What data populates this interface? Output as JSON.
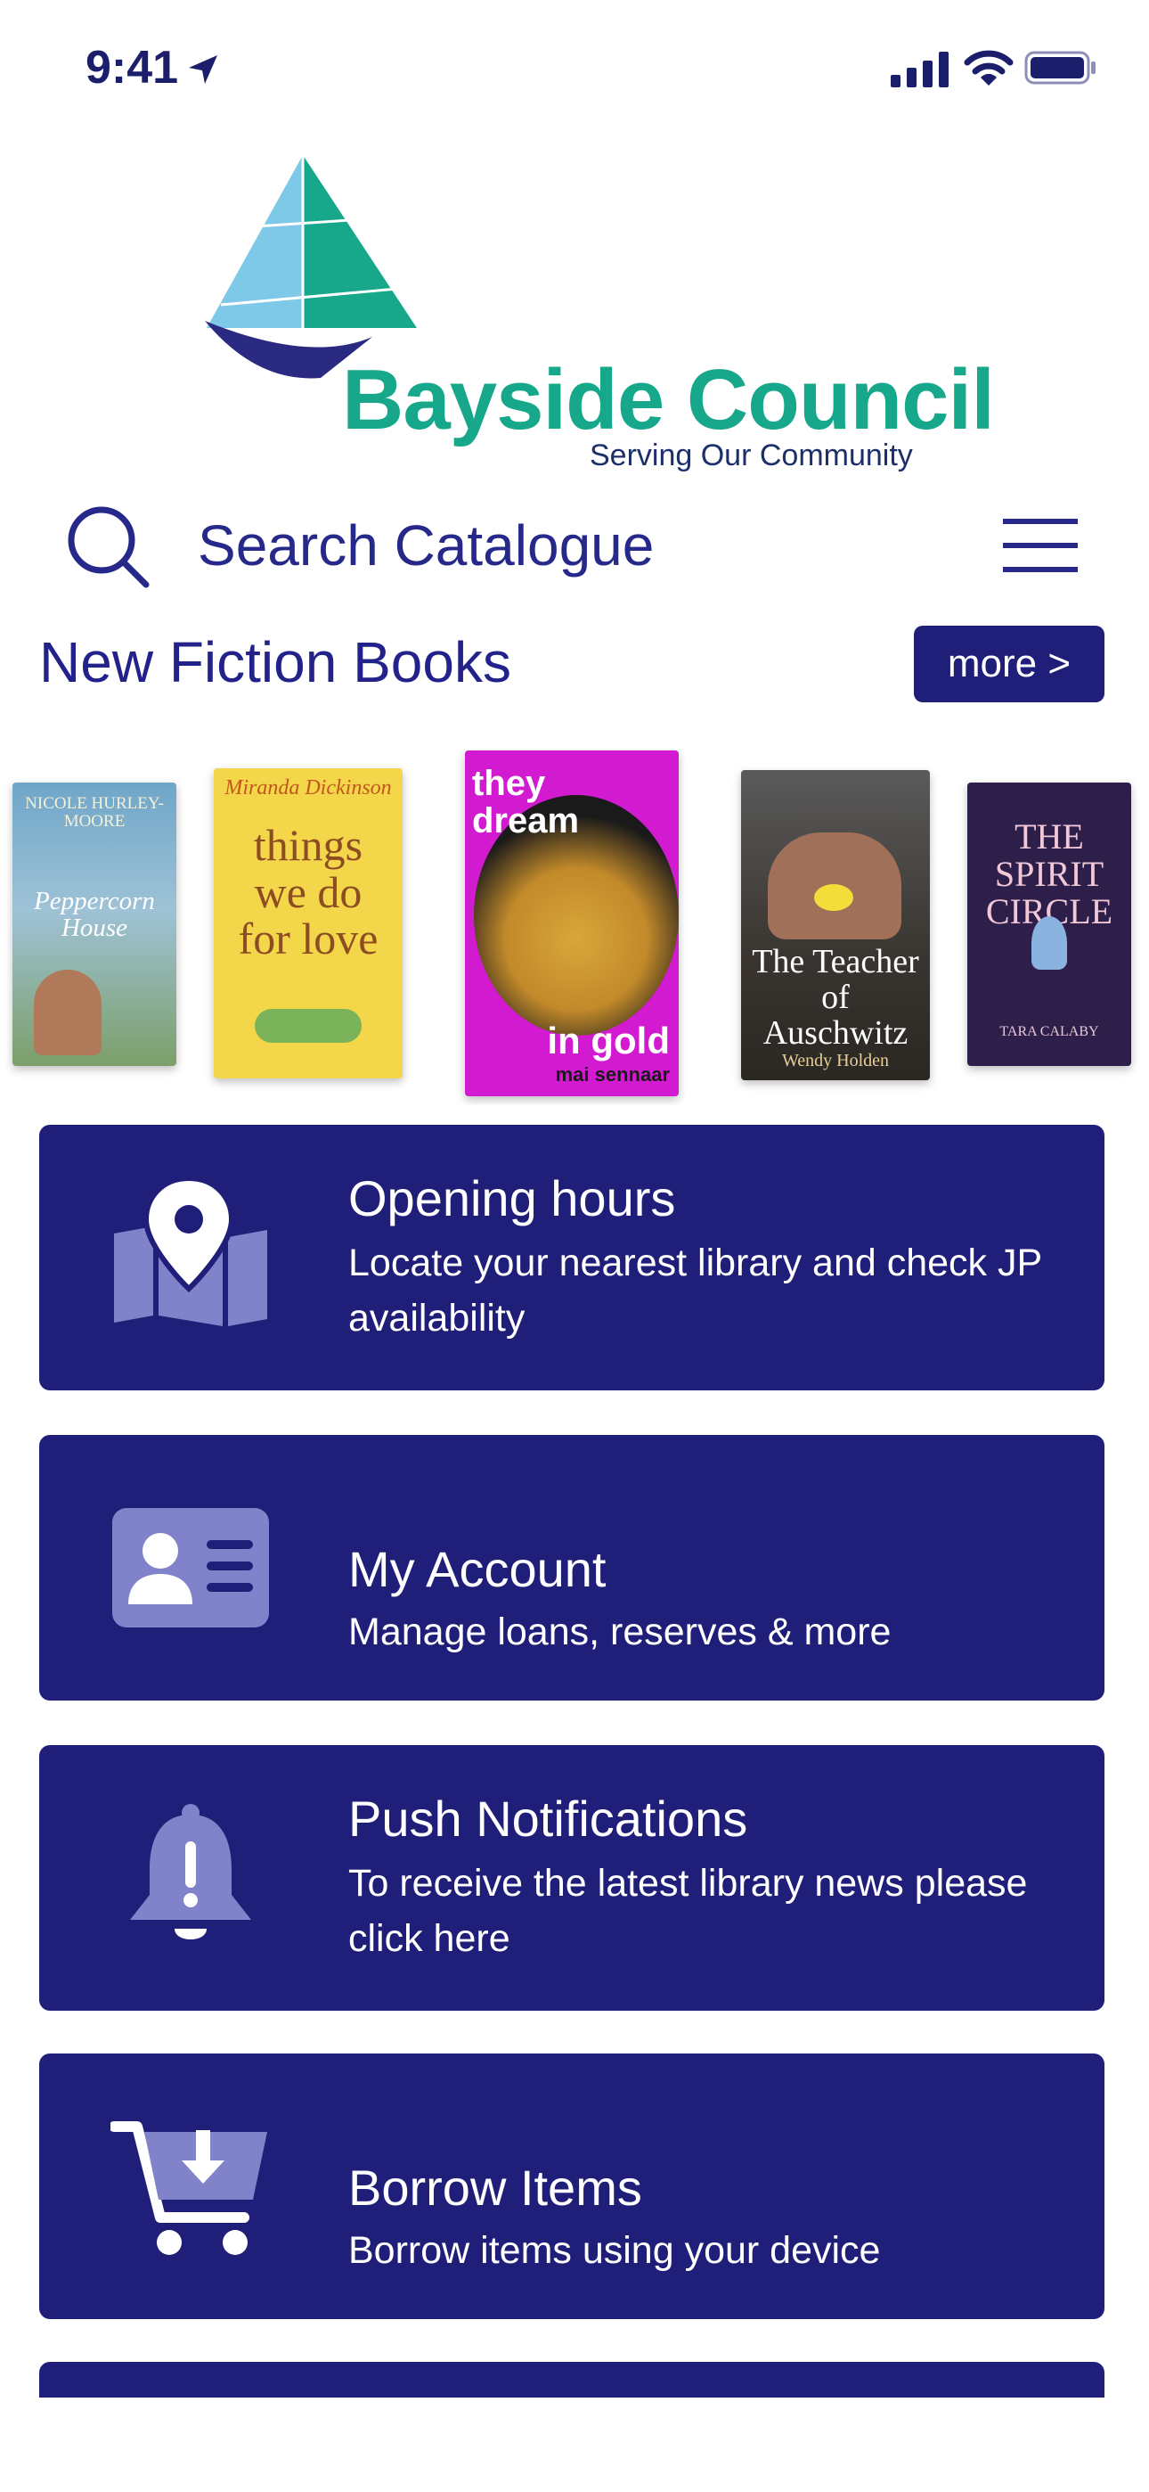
{
  "status_bar": {
    "time": "9:41"
  },
  "logo": {
    "title": "Bayside Council",
    "subtitle": "Serving Our Community"
  },
  "search": {
    "placeholder": "Search Catalogue"
  },
  "section": {
    "title": "New Fiction Books",
    "more_label": "more >"
  },
  "books": [
    {
      "author": "NICOLE HURLEY-MOORE",
      "title": "Peppercorn House"
    },
    {
      "author": "Miranda Dickinson",
      "title": "things we do for love"
    },
    {
      "author": "mai sennaar",
      "title_top": "they dream",
      "title_bottom": "in gold"
    },
    {
      "author": "Wendy Holden",
      "title": "The Teacher of Auschwitz"
    },
    {
      "author": "TARA CALABY",
      "title": "THE SPIRIT CIRCLE"
    }
  ],
  "cards": [
    {
      "icon": "map-pin-icon",
      "title": "Opening hours",
      "description": "Locate your nearest library and check JP availability"
    },
    {
      "icon": "id-card-icon",
      "title": "My Account",
      "description": "Manage loans, reserves & more"
    },
    {
      "icon": "bell-icon",
      "title": "Push Notifications",
      "description": "To receive the latest library news please click here"
    },
    {
      "icon": "cart-download-icon",
      "title": "Borrow Items",
      "description": "Borrow items using your device"
    }
  ],
  "colors": {
    "brand_navy": "#1f1f7a",
    "logo_green": "#17a88c",
    "icon_lavender": "#8083c9"
  }
}
